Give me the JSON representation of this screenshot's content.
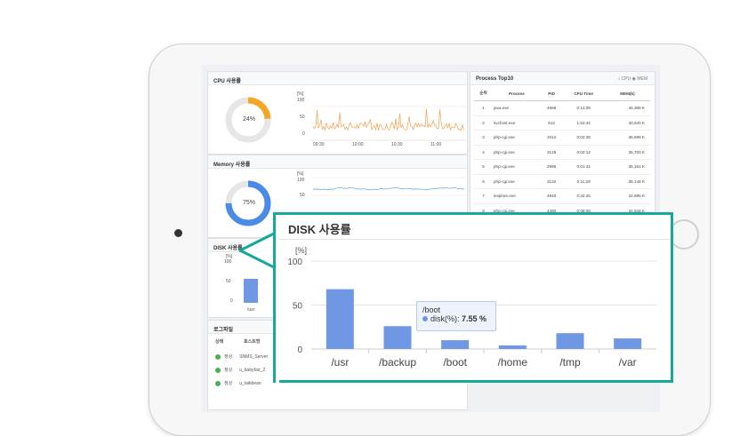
{
  "cpu_panel": {
    "title": "CPU 사용률",
    "gauge_label": "24%",
    "gauge_value": 0.24,
    "y_unit": "[%]",
    "y_ticks": [
      "100",
      "50",
      "0"
    ],
    "x_ticks": [
      "09:30",
      "10:00",
      "10:30",
      "11:00"
    ],
    "color": "#f5a623"
  },
  "memory_panel": {
    "title": "Memory 사용률",
    "gauge_label": "75%",
    "gauge_value": 0.75,
    "y_unit": "[%]",
    "y_ticks": [
      "100",
      "50"
    ],
    "color": "#4a8be8"
  },
  "disk_panel": {
    "title": "DISK 사용률",
    "y_unit": "[%]",
    "y_ticks": [
      "100",
      "50",
      "0"
    ],
    "first_category": "/usr"
  },
  "process_panel": {
    "title": "Process Top10",
    "legend": [
      "CPU",
      "MEM"
    ],
    "columns": [
      "순위",
      "Process",
      "PID",
      "CPU Time",
      "MEM(k)"
    ],
    "rows": [
      {
        "rank": "1",
        "process": "java.exe",
        "pid": "4868",
        "cpu_time": "0:14:09",
        "mem": "46,388 K"
      },
      {
        "rank": "2",
        "process": "svchost.exe",
        "pid": "812",
        "cpu_time": "1:52:44",
        "mem": "40,940 K"
      },
      {
        "rank": "3",
        "process": "php-cgi.exe",
        "pid": "3312",
        "cpu_time": "0:02:26",
        "mem": "36,896 K"
      },
      {
        "rank": "4",
        "process": "php-cgi.exe",
        "pid": "3128",
        "cpu_time": "0:02:12",
        "mem": "35,700 K"
      },
      {
        "rank": "5",
        "process": "php-cgi.exe",
        "pid": "2996",
        "cpu_time": "0:01:42",
        "mem": "35,164 K"
      },
      {
        "rank": "6",
        "process": "php-cgi.exe",
        "pid": "3132",
        "cpu_time": "0:11:29",
        "mem": "35,148 K"
      },
      {
        "rank": "7",
        "process": "iexplore.exe",
        "pid": "4940",
        "cpu_time": "0:42:25",
        "mem": "34,896 K"
      },
      {
        "rank": "8",
        "process": "php-cgi.exe",
        "pid": "4460",
        "cpu_time": "0:08:06",
        "mem": "34,648 K"
      },
      {
        "rank": "9",
        "process": "php-cgi.exe",
        "pid": "3988",
        "cpu_time": "0:00:50",
        "mem": "34,596 K"
      }
    ]
  },
  "log_panel": {
    "title": "로그파일",
    "columns": [
      "상태",
      "호스트명"
    ],
    "rows": [
      {
        "status": "정상",
        "host": "SNMS_Server"
      },
      {
        "status": "정상",
        "host": "u_babyfair_2"
      },
      {
        "status": "정상",
        "host": "u_taikbean"
      }
    ]
  },
  "disk_callout": {
    "title": "DISK 사용률",
    "tooltip": {
      "category": "/boot",
      "series": "disk(%):",
      "value": "7.55 %"
    }
  },
  "chart_data": {
    "type": "bar",
    "title": "DISK 사용률",
    "ylabel": "[%]",
    "xlabel": "",
    "ylim": [
      0,
      100
    ],
    "yticks": [
      0,
      50,
      100
    ],
    "categories": [
      "/usr",
      "/backup",
      "/boot",
      "/home",
      "/tmp",
      "/var"
    ],
    "values": [
      68,
      26,
      10,
      4,
      18,
      12
    ],
    "color": "#6f97e4",
    "highlight_category": "/boot",
    "grid": true
  }
}
